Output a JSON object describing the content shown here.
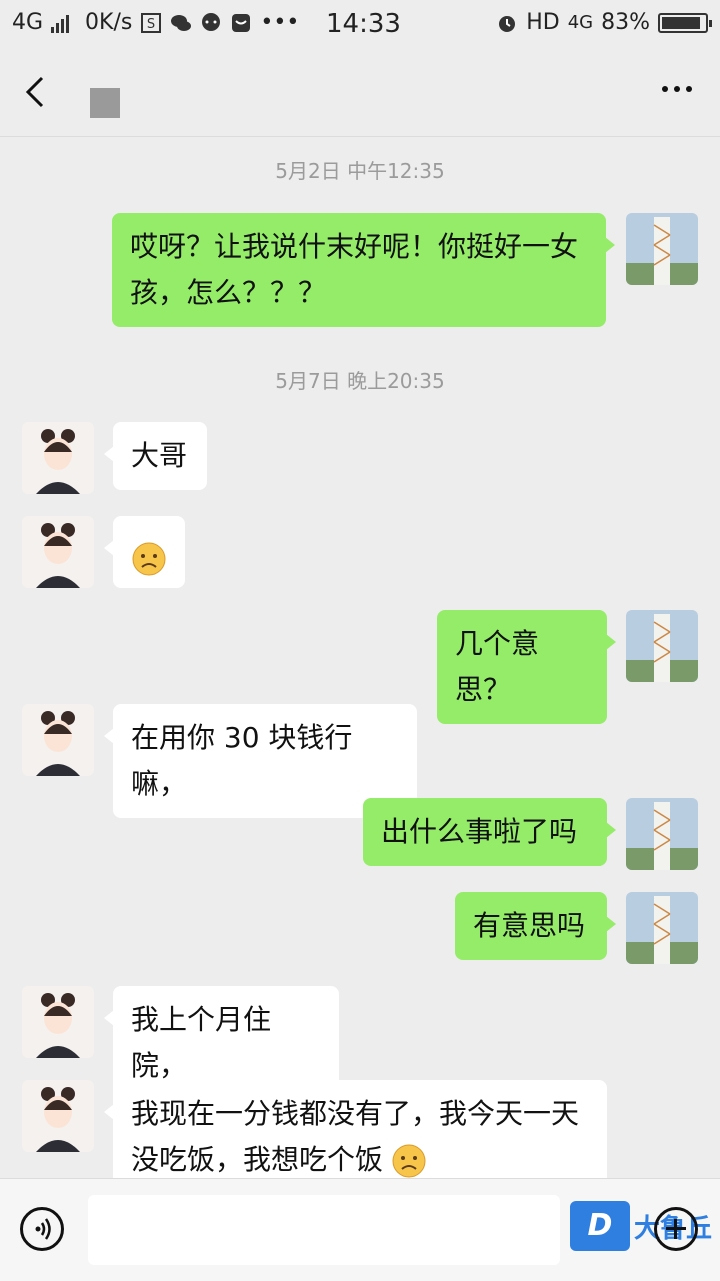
{
  "status_bar": {
    "network": "4G",
    "speed": "0K/s",
    "more": "•••",
    "time": "14:33",
    "hd": "HD",
    "net2": "4G",
    "battery": "83%"
  },
  "messages": [
    {
      "type": "timestamp",
      "text": "5月2日 中午12:35"
    },
    {
      "type": "me",
      "text": "哎呀？让我说什末好呢！你挺好一女孩，怎么？？？"
    },
    {
      "type": "timestamp",
      "text": "5月7日 晚上20:35"
    },
    {
      "type": "them",
      "text": "大哥"
    },
    {
      "type": "them",
      "text": "",
      "emoji": "sad-face"
    },
    {
      "type": "me",
      "text": "几个意思？"
    },
    {
      "type": "them",
      "text": "在用你 30 块钱行嘛，"
    },
    {
      "type": "me",
      "text": "出什么事啦了吗"
    },
    {
      "type": "me",
      "text": "有意思吗"
    },
    {
      "type": "them",
      "text": "我上个月住院，"
    },
    {
      "type": "them",
      "text": "我现在一分钱都没有了，我今天一天没吃饭，我想吃个饭",
      "emoji": "sad-face"
    }
  ],
  "watermark": {
    "logo": "D",
    "text": "大鲁丘"
  },
  "colors": {
    "bubble_me": "#95ec69",
    "bubble_them": "#ffffff",
    "background": "#ededed"
  }
}
